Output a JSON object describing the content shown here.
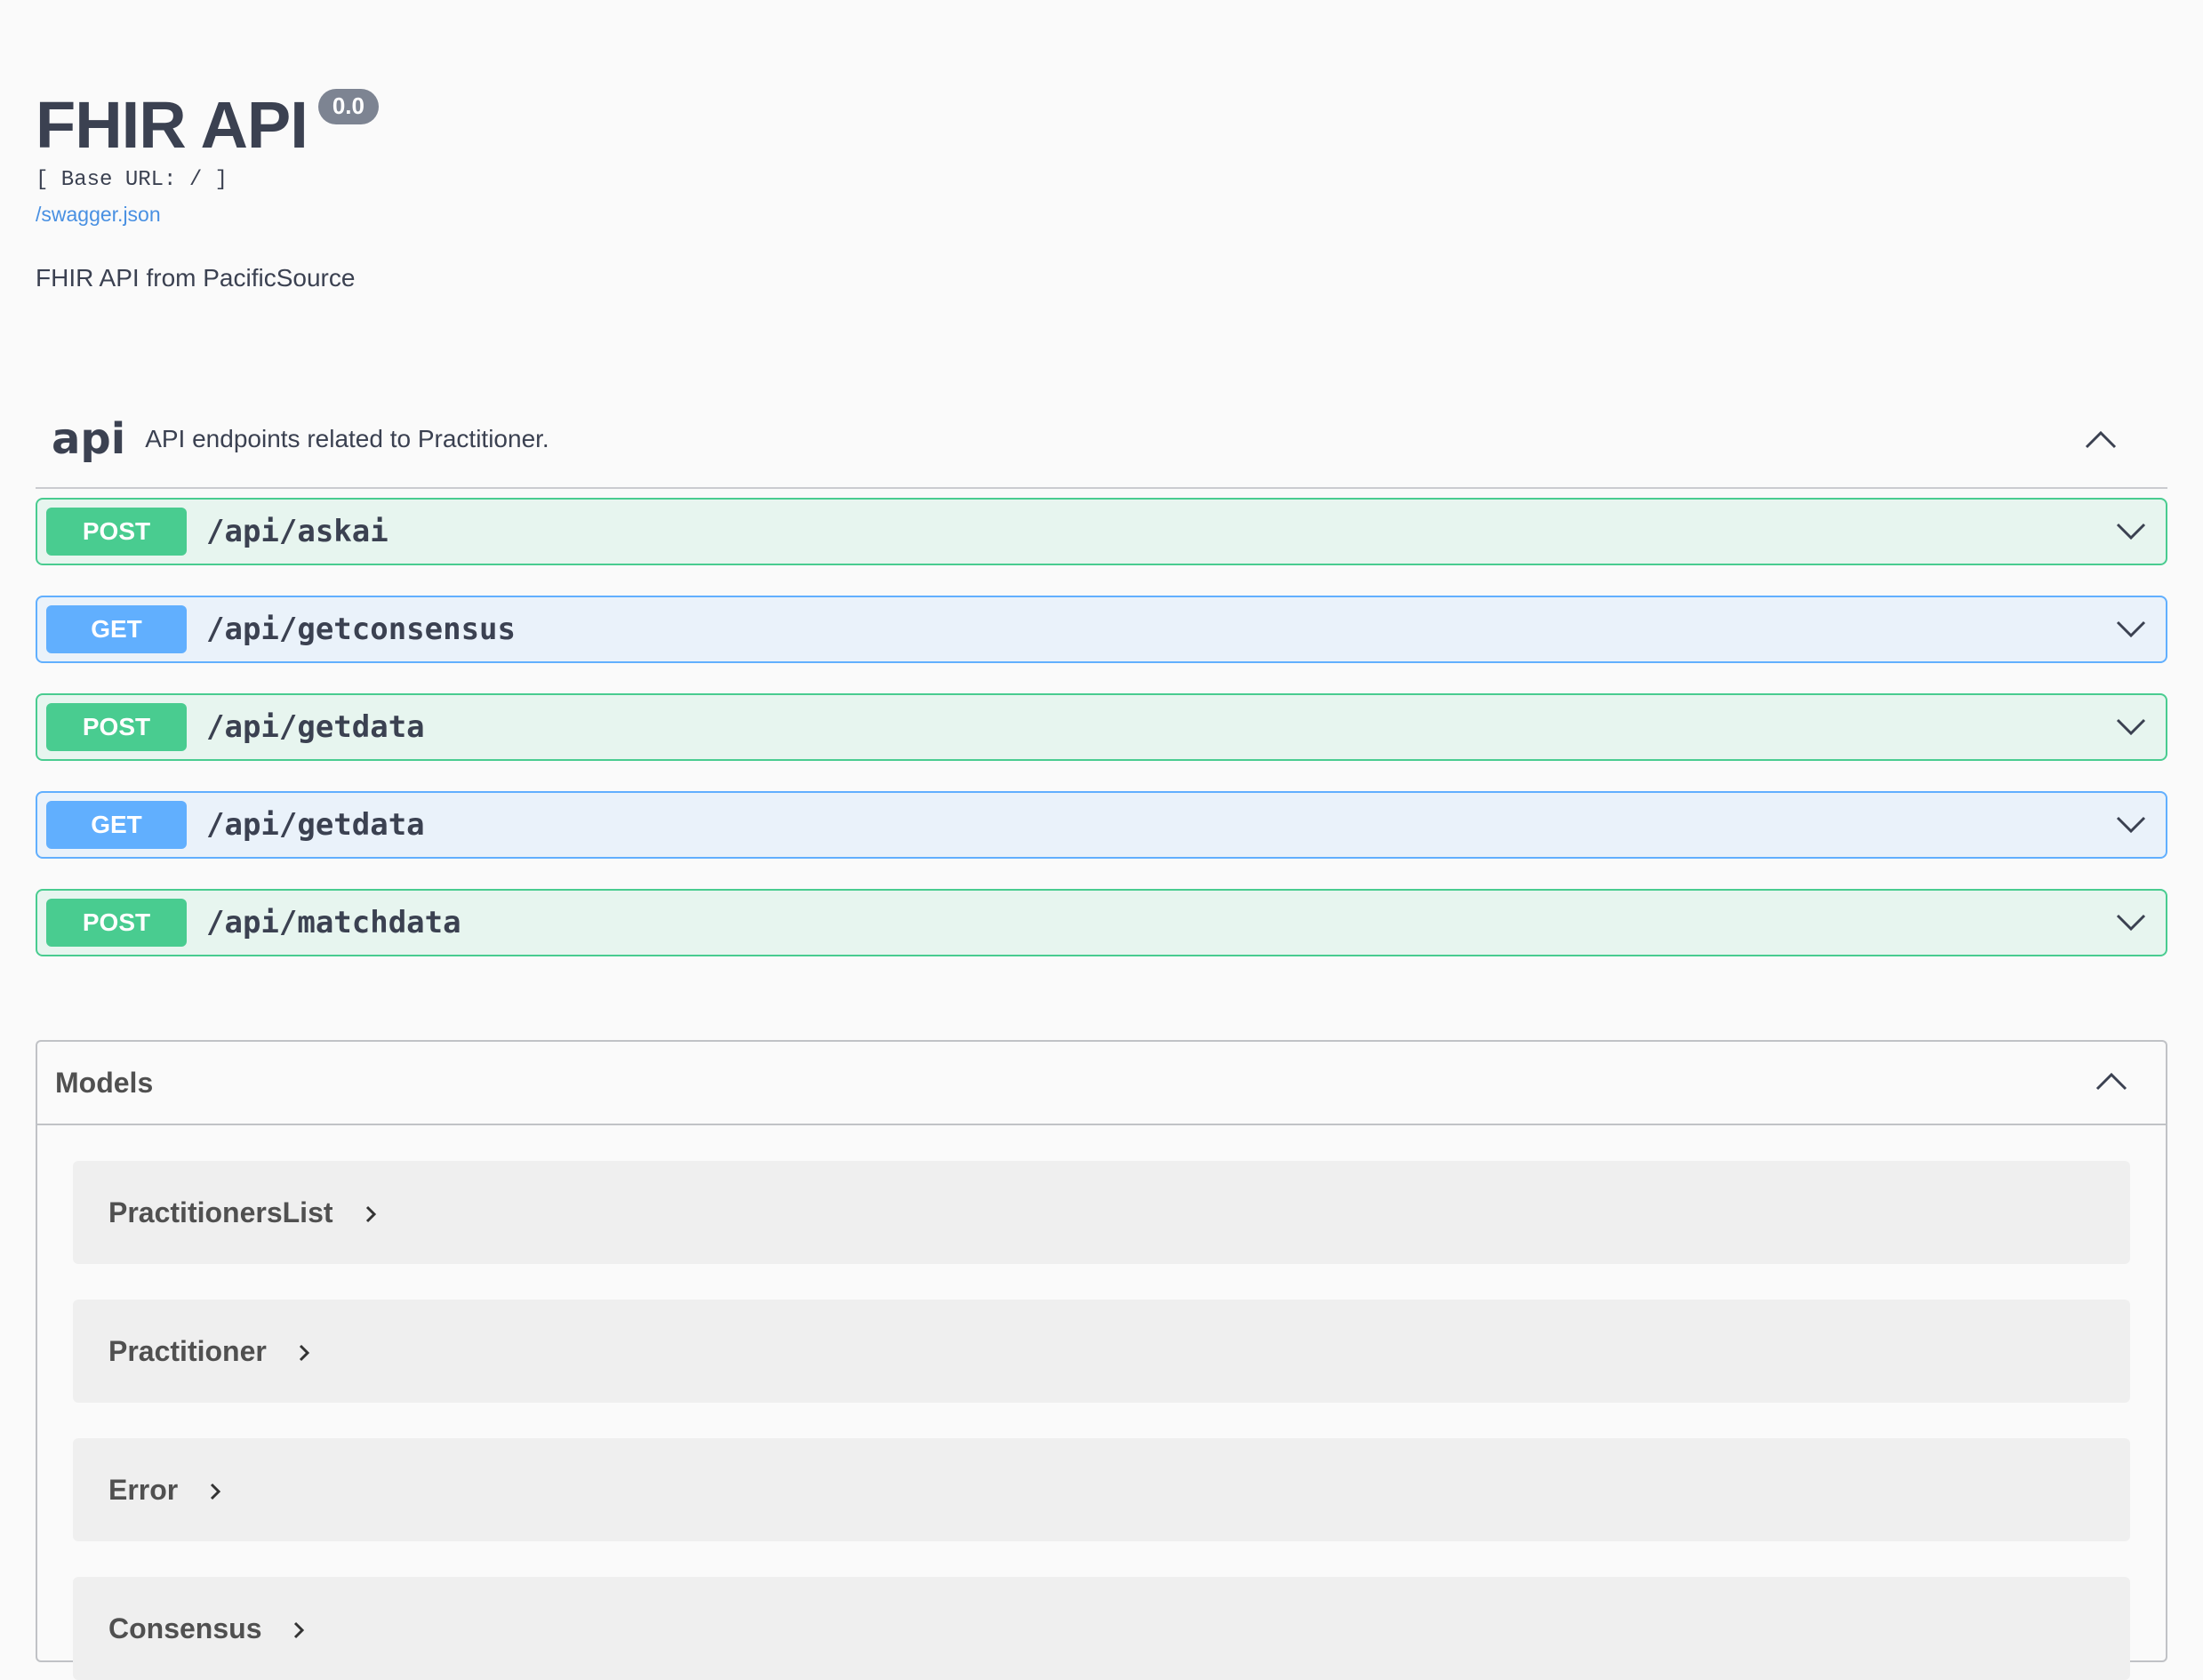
{
  "info": {
    "title": "FHIR API",
    "version": "0.0",
    "base_url": "[ Base URL: / ]",
    "spec_link": "/swagger.json",
    "description": "FHIR API from PacificSource"
  },
  "tag": {
    "name": "api",
    "description": "API endpoints related to Practitioner."
  },
  "operations": [
    {
      "method": "POST",
      "path": "/api/askai"
    },
    {
      "method": "GET",
      "path": "/api/getconsensus"
    },
    {
      "method": "POST",
      "path": "/api/getdata"
    },
    {
      "method": "GET",
      "path": "/api/getdata"
    },
    {
      "method": "POST",
      "path": "/api/matchdata"
    }
  ],
  "models": {
    "title": "Models",
    "items": [
      {
        "name": "PractitionersList"
      },
      {
        "name": "Practitioner"
      },
      {
        "name": "Error"
      },
      {
        "name": "Consensus"
      }
    ]
  },
  "colors": {
    "post": "#49cc90",
    "get": "#61affe",
    "text": "#3b4151",
    "link": "#4990e2",
    "version_badge": "#7d8492"
  },
  "icons": {
    "tag_toggle": "chevron-up-icon",
    "op_toggle": "chevron-down-icon",
    "models_toggle": "chevron-up-icon",
    "model_expand": "chevron-right-icon"
  }
}
